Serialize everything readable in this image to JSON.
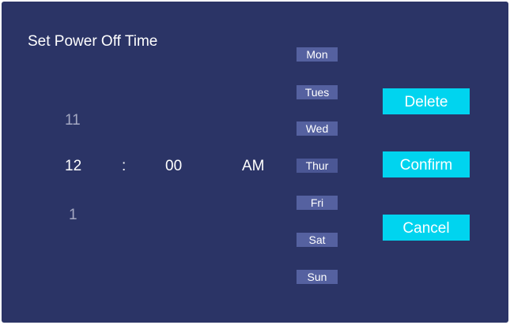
{
  "dialog": {
    "title": "Set Power Off Time"
  },
  "time_picker": {
    "hour": {
      "previous": "11",
      "selected": "12",
      "next": "1"
    },
    "separator": ":",
    "minute": {
      "selected": "00"
    },
    "period": {
      "selected": "AM"
    }
  },
  "days": [
    {
      "label": "Mon"
    },
    {
      "label": "Tues"
    },
    {
      "label": "Wed"
    },
    {
      "label": "Thur"
    },
    {
      "label": "Fri"
    },
    {
      "label": "Sat"
    },
    {
      "label": "Sun"
    }
  ],
  "actions": {
    "delete_label": "Delete",
    "confirm_label": "Confirm",
    "cancel_label": "Cancel"
  },
  "colors": {
    "background": "#2b3466",
    "day_chip": "#5561a0",
    "action_button": "#00d4ef",
    "dim_text": "#a4a8c2"
  }
}
